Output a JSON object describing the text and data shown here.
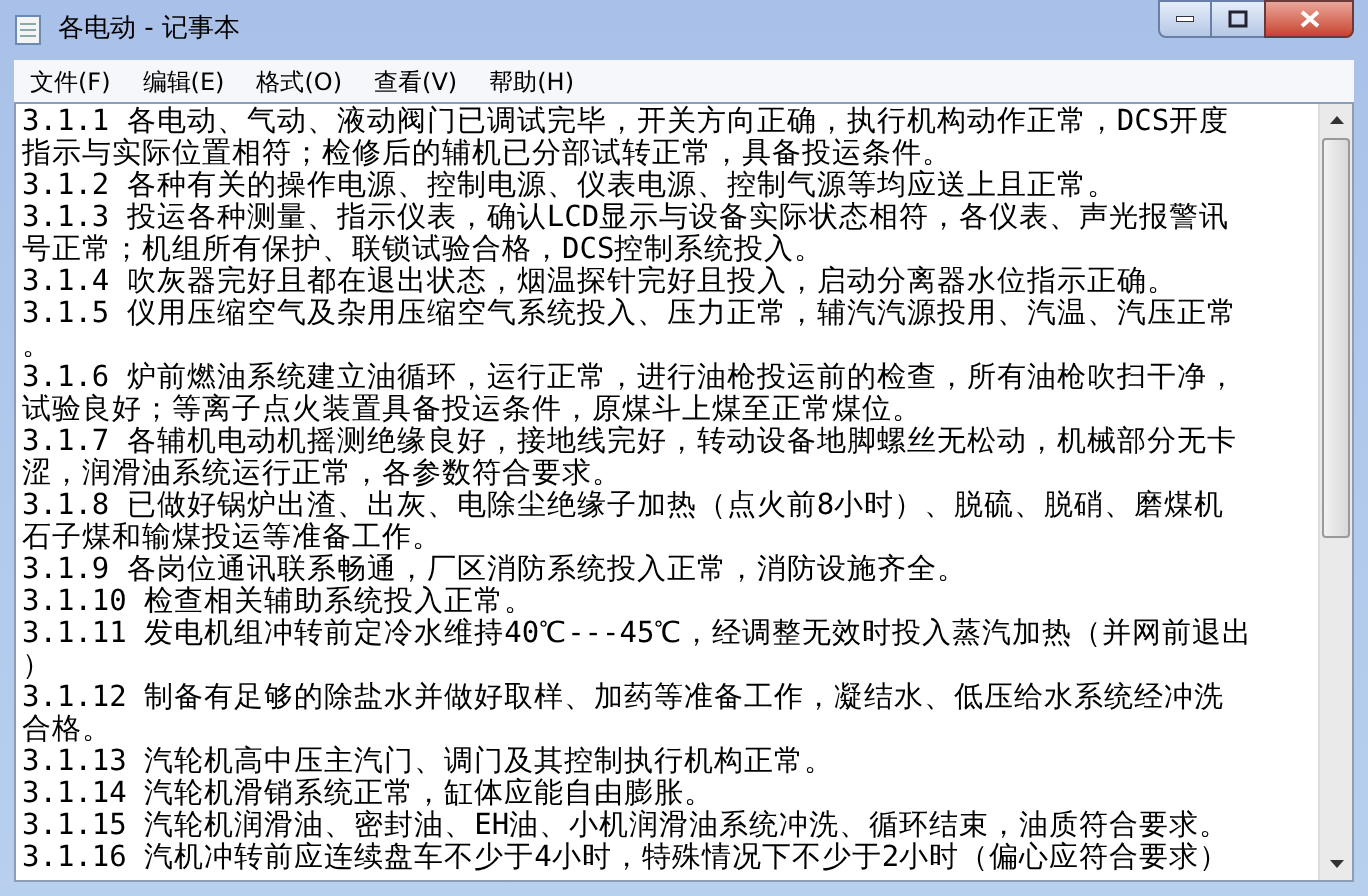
{
  "window": {
    "title": "各电动 - 记事本"
  },
  "menu": [
    "文件(F)",
    "编辑(E)",
    "格式(O)",
    "查看(V)",
    "帮助(H)"
  ],
  "lines": [
    "3.1.1 各电动、气动、液动阀门已调试完毕，开关方向正确，执行机构动作正常，DCS开度",
    "指示与实际位置相符；检修后的辅机已分部试转正常，具备投运条件。",
    "3.1.2 各种有关的操作电源、控制电源、仪表电源、控制气源等均应送上且正常。",
    "3.1.3 投运各种测量、指示仪表，确认LCD显示与设备实际状态相符，各仪表、声光报警讯",
    "号正常；机组所有保护、联锁试验合格，DCS控制系统投入。",
    "3.1.4 吹灰器完好且都在退出状态，烟温探针完好且投入，启动分离器水位指示正确。",
    "3.1.5 仪用压缩空气及杂用压缩空气系统投入、压力正常，辅汽汽源投用、汽温、汽压正常",
    "。",
    "3.1.6 炉前燃油系统建立油循环，运行正常，进行油枪投运前的检查，所有油枪吹扫干净，",
    "试验良好；等离子点火装置具备投运条件，原煤斗上煤至正常煤位。",
    "3.1.7 各辅机电动机摇测绝缘良好，接地线完好，转动设备地脚螺丝无松动，机械部分无卡",
    "涩，润滑油系统运行正常，各参数符合要求。",
    "3.1.8 已做好锅炉出渣、出灰、电除尘绝缘子加热（点火前8小时）、脱硫、脱硝、磨煤机",
    "石子煤和输煤投运等准备工作。",
    "3.1.9 各岗位通讯联系畅通，厂区消防系统投入正常，消防设施齐全。",
    "3.1.10 检查相关辅助系统投入正常。",
    "3.1.11 发电机组冲转前定冷水维持40℃---45℃，经调整无效时投入蒸汽加热（并网前退出",
    "）",
    "3.1.12 制备有足够的除盐水并做好取样、加药等准备工作，凝结水、低压给水系统经冲洗",
    "合格。",
    "3.1.13 汽轮机高中压主汽门、调门及其控制执行机构正常。",
    "3.1.14 汽轮机滑销系统正常，缸体应能自由膨胀。",
    "3.1.15 汽轮机润滑油、密封油、EH油、小机润滑油系统冲洗、循环结束，油质符合要求。",
    "3.1.16 汽机冲转前应连续盘车不少于4小时，特殊情况下不少于2小时（偏心应符合要求）"
  ]
}
